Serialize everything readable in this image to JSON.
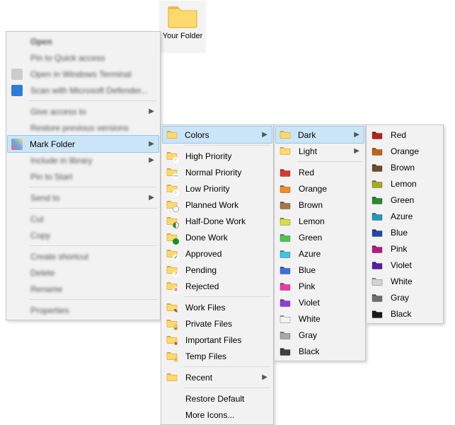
{
  "folder": {
    "label": "Your Folder"
  },
  "ctx": {
    "open": "Open",
    "pin_quick": "Pin to Quick access",
    "open_terminal": "Open in Windows Terminal",
    "scan_defender": "Scan with Microsoft Defender...",
    "give_access": "Give access to",
    "restore_prev": "Restore previous versions",
    "mark_folder": "Mark Folder",
    "include_lib": "Include in library",
    "pin_start": "Pin to Start",
    "send_to": "Send to",
    "cut": "Cut",
    "copy": "Copy",
    "create_shortcut": "Create shortcut",
    "delete": "Delete",
    "rename": "Rename",
    "properties": "Properties"
  },
  "mark": {
    "colors": "Colors",
    "high_pri": "High Priority",
    "normal_pri": "Normal Priority",
    "low_pri": "Low Priority",
    "planned": "Planned Work",
    "half_done": "Half-Done Work",
    "done": "Done Work",
    "approved": "Approved",
    "pending": "Pending",
    "rejected": "Rejected",
    "work_files": "Work Files",
    "private_files": "Private Files",
    "important_files": "Important Files",
    "temp_files": "Temp Files",
    "recent": "Recent",
    "restore": "Restore Default",
    "more": "More Icons..."
  },
  "shades": {
    "dark": "Dark",
    "light": "Light"
  },
  "colors": {
    "red": {
      "label": "Red",
      "hex": "#d83a2b",
      "dark": "#b5231a"
    },
    "orange": {
      "label": "Orange",
      "hex": "#f58b1f",
      "dark": "#c56410"
    },
    "brown": {
      "label": "Brown",
      "hex": "#a87742",
      "dark": "#6d4c28"
    },
    "lemon": {
      "label": "Lemon",
      "hex": "#d6e23b",
      "dark": "#a8ab1f"
    },
    "green": {
      "label": "Green",
      "hex": "#46c84a",
      "dark": "#2a8a2e"
    },
    "azure": {
      "label": "Azure",
      "hex": "#3cc6e8",
      "dark": "#1f9abd"
    },
    "blue": {
      "label": "Blue",
      "hex": "#3a6fe0",
      "dark": "#2246a8"
    },
    "pink": {
      "label": "Pink",
      "hex": "#e83ba8",
      "dark": "#b51a7e"
    },
    "violet": {
      "label": "Violet",
      "hex": "#8f3de0",
      "dark": "#5a1ea8"
    },
    "white": {
      "label": "White",
      "hex": "#f4f4f4",
      "dark": "#d4d4d4"
    },
    "gray": {
      "label": "Gray",
      "hex": "#a8a8a8",
      "dark": "#6e6e6e"
    },
    "black": {
      "label": "Black",
      "hex": "#404040",
      "dark": "#1a1a1a"
    }
  },
  "color_order": [
    "red",
    "orange",
    "brown",
    "lemon",
    "green",
    "azure",
    "blue",
    "pink",
    "violet",
    "white",
    "gray",
    "black"
  ]
}
